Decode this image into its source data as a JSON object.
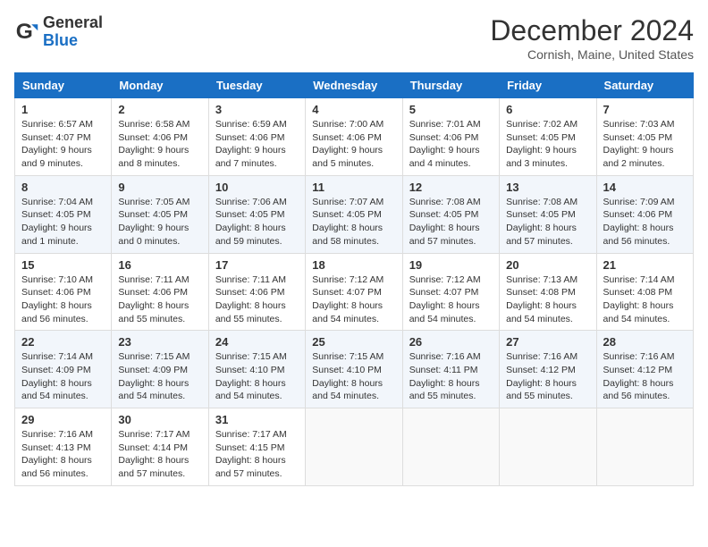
{
  "header": {
    "logo_general": "General",
    "logo_blue": "Blue",
    "title": "December 2024",
    "location": "Cornish, Maine, United States"
  },
  "days_of_week": [
    "Sunday",
    "Monday",
    "Tuesday",
    "Wednesday",
    "Thursday",
    "Friday",
    "Saturday"
  ],
  "weeks": [
    [
      {
        "day": "1",
        "lines": [
          "Sunrise: 6:57 AM",
          "Sunset: 4:07 PM",
          "Daylight: 9 hours",
          "and 9 minutes."
        ]
      },
      {
        "day": "2",
        "lines": [
          "Sunrise: 6:58 AM",
          "Sunset: 4:06 PM",
          "Daylight: 9 hours",
          "and 8 minutes."
        ]
      },
      {
        "day": "3",
        "lines": [
          "Sunrise: 6:59 AM",
          "Sunset: 4:06 PM",
          "Daylight: 9 hours",
          "and 7 minutes."
        ]
      },
      {
        "day": "4",
        "lines": [
          "Sunrise: 7:00 AM",
          "Sunset: 4:06 PM",
          "Daylight: 9 hours",
          "and 5 minutes."
        ]
      },
      {
        "day": "5",
        "lines": [
          "Sunrise: 7:01 AM",
          "Sunset: 4:06 PM",
          "Daylight: 9 hours",
          "and 4 minutes."
        ]
      },
      {
        "day": "6",
        "lines": [
          "Sunrise: 7:02 AM",
          "Sunset: 4:05 PM",
          "Daylight: 9 hours",
          "and 3 minutes."
        ]
      },
      {
        "day": "7",
        "lines": [
          "Sunrise: 7:03 AM",
          "Sunset: 4:05 PM",
          "Daylight: 9 hours",
          "and 2 minutes."
        ]
      }
    ],
    [
      {
        "day": "8",
        "lines": [
          "Sunrise: 7:04 AM",
          "Sunset: 4:05 PM",
          "Daylight: 9 hours",
          "and 1 minute."
        ]
      },
      {
        "day": "9",
        "lines": [
          "Sunrise: 7:05 AM",
          "Sunset: 4:05 PM",
          "Daylight: 9 hours",
          "and 0 minutes."
        ]
      },
      {
        "day": "10",
        "lines": [
          "Sunrise: 7:06 AM",
          "Sunset: 4:05 PM",
          "Daylight: 8 hours",
          "and 59 minutes."
        ]
      },
      {
        "day": "11",
        "lines": [
          "Sunrise: 7:07 AM",
          "Sunset: 4:05 PM",
          "Daylight: 8 hours",
          "and 58 minutes."
        ]
      },
      {
        "day": "12",
        "lines": [
          "Sunrise: 7:08 AM",
          "Sunset: 4:05 PM",
          "Daylight: 8 hours",
          "and 57 minutes."
        ]
      },
      {
        "day": "13",
        "lines": [
          "Sunrise: 7:08 AM",
          "Sunset: 4:05 PM",
          "Daylight: 8 hours",
          "and 57 minutes."
        ]
      },
      {
        "day": "14",
        "lines": [
          "Sunrise: 7:09 AM",
          "Sunset: 4:06 PM",
          "Daylight: 8 hours",
          "and 56 minutes."
        ]
      }
    ],
    [
      {
        "day": "15",
        "lines": [
          "Sunrise: 7:10 AM",
          "Sunset: 4:06 PM",
          "Daylight: 8 hours",
          "and 56 minutes."
        ]
      },
      {
        "day": "16",
        "lines": [
          "Sunrise: 7:11 AM",
          "Sunset: 4:06 PM",
          "Daylight: 8 hours",
          "and 55 minutes."
        ]
      },
      {
        "day": "17",
        "lines": [
          "Sunrise: 7:11 AM",
          "Sunset: 4:06 PM",
          "Daylight: 8 hours",
          "and 55 minutes."
        ]
      },
      {
        "day": "18",
        "lines": [
          "Sunrise: 7:12 AM",
          "Sunset: 4:07 PM",
          "Daylight: 8 hours",
          "and 54 minutes."
        ]
      },
      {
        "day": "19",
        "lines": [
          "Sunrise: 7:12 AM",
          "Sunset: 4:07 PM",
          "Daylight: 8 hours",
          "and 54 minutes."
        ]
      },
      {
        "day": "20",
        "lines": [
          "Sunrise: 7:13 AM",
          "Sunset: 4:08 PM",
          "Daylight: 8 hours",
          "and 54 minutes."
        ]
      },
      {
        "day": "21",
        "lines": [
          "Sunrise: 7:14 AM",
          "Sunset: 4:08 PM",
          "Daylight: 8 hours",
          "and 54 minutes."
        ]
      }
    ],
    [
      {
        "day": "22",
        "lines": [
          "Sunrise: 7:14 AM",
          "Sunset: 4:09 PM",
          "Daylight: 8 hours",
          "and 54 minutes."
        ]
      },
      {
        "day": "23",
        "lines": [
          "Sunrise: 7:15 AM",
          "Sunset: 4:09 PM",
          "Daylight: 8 hours",
          "and 54 minutes."
        ]
      },
      {
        "day": "24",
        "lines": [
          "Sunrise: 7:15 AM",
          "Sunset: 4:10 PM",
          "Daylight: 8 hours",
          "and 54 minutes."
        ]
      },
      {
        "day": "25",
        "lines": [
          "Sunrise: 7:15 AM",
          "Sunset: 4:10 PM",
          "Daylight: 8 hours",
          "and 54 minutes."
        ]
      },
      {
        "day": "26",
        "lines": [
          "Sunrise: 7:16 AM",
          "Sunset: 4:11 PM",
          "Daylight: 8 hours",
          "and 55 minutes."
        ]
      },
      {
        "day": "27",
        "lines": [
          "Sunrise: 7:16 AM",
          "Sunset: 4:12 PM",
          "Daylight: 8 hours",
          "and 55 minutes."
        ]
      },
      {
        "day": "28",
        "lines": [
          "Sunrise: 7:16 AM",
          "Sunset: 4:12 PM",
          "Daylight: 8 hours",
          "and 56 minutes."
        ]
      }
    ],
    [
      {
        "day": "29",
        "lines": [
          "Sunrise: 7:16 AM",
          "Sunset: 4:13 PM",
          "Daylight: 8 hours",
          "and 56 minutes."
        ]
      },
      {
        "day": "30",
        "lines": [
          "Sunrise: 7:17 AM",
          "Sunset: 4:14 PM",
          "Daylight: 8 hours",
          "and 57 minutes."
        ]
      },
      {
        "day": "31",
        "lines": [
          "Sunrise: 7:17 AM",
          "Sunset: 4:15 PM",
          "Daylight: 8 hours",
          "and 57 minutes."
        ]
      },
      {
        "day": "",
        "lines": []
      },
      {
        "day": "",
        "lines": []
      },
      {
        "day": "",
        "lines": []
      },
      {
        "day": "",
        "lines": []
      }
    ]
  ]
}
